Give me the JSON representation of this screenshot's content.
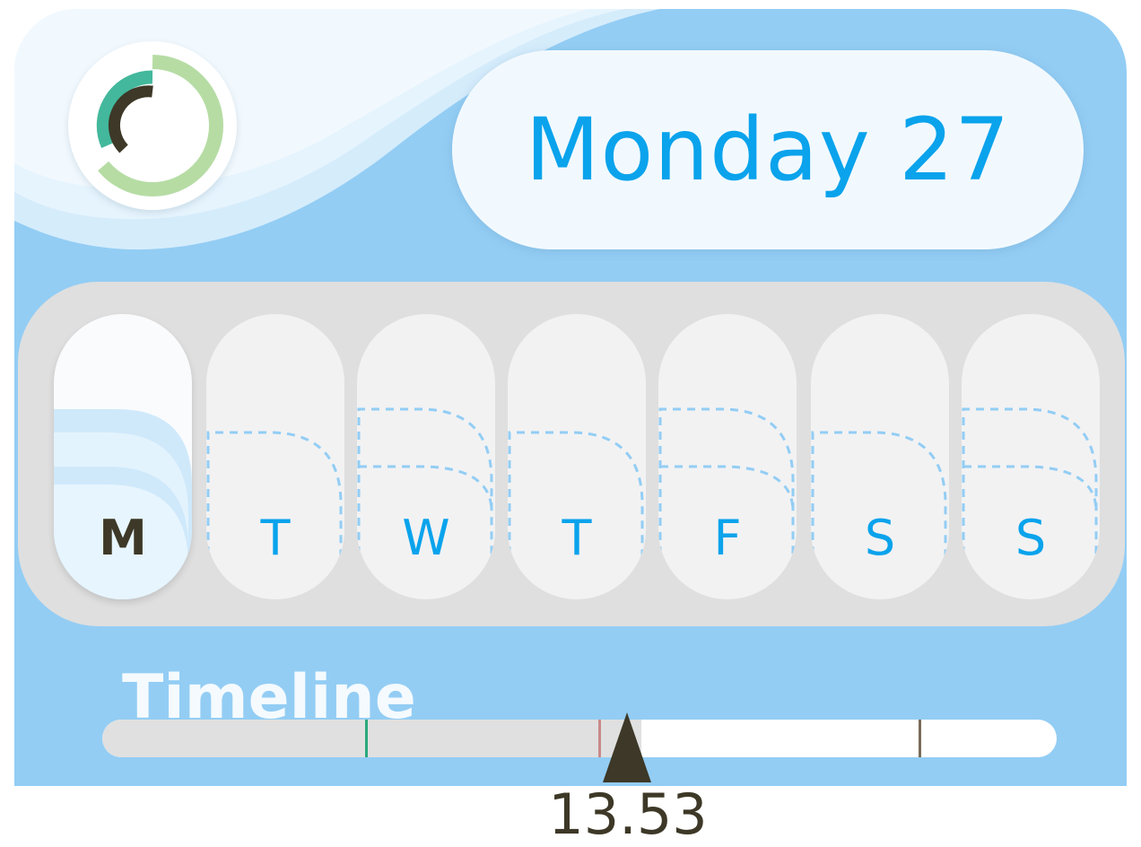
{
  "header": {
    "date_label": "Monday 27",
    "logo_icon": "progress-ring-icon"
  },
  "week": {
    "days": [
      {
        "letter": "M",
        "active": true,
        "level": 2
      },
      {
        "letter": "T",
        "active": false,
        "level": 1
      },
      {
        "letter": "W",
        "active": false,
        "level": 2
      },
      {
        "letter": "T",
        "active": false,
        "level": 1
      },
      {
        "letter": "F",
        "active": false,
        "level": 2
      },
      {
        "letter": "S",
        "active": false,
        "level": 1
      },
      {
        "letter": "S",
        "active": false,
        "level": 2
      }
    ]
  },
  "timeline": {
    "label": "Timeline",
    "current_time": "13.53",
    "progress_percent": 56.5,
    "markers": [
      {
        "percent": 27.5,
        "color": "#2aa87c"
      },
      {
        "percent": 52.0,
        "color": "#c98a88"
      },
      {
        "percent": 85.5,
        "color": "#7a6c5a"
      }
    ]
  },
  "colors": {
    "background": "#93cdf4",
    "accent": "#0aa3ec",
    "dark": "#3d3827",
    "tray": "#dfdfdf"
  }
}
